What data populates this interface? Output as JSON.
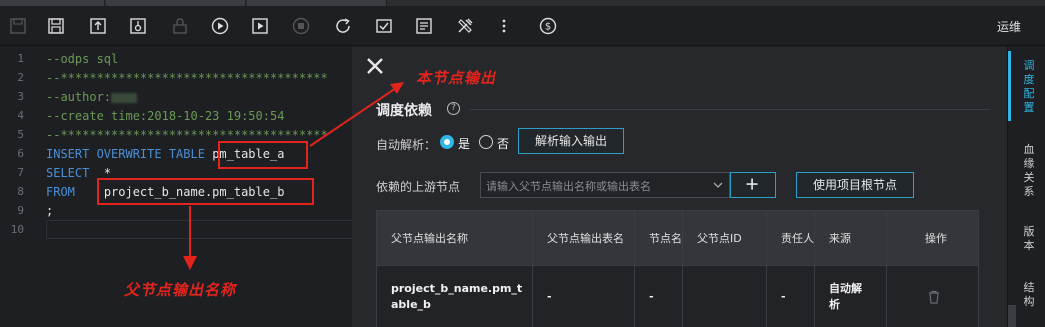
{
  "toolbar": {
    "buttons": [
      "save-icon",
      "submit-icon",
      "steal-lock-icon",
      "unlock-icon",
      "run-icon",
      "run-with-params-icon",
      "stop-icon",
      "reload-icon",
      "precompile-icon",
      "format-icon",
      "tools-icon",
      "more-icon",
      "cost-estimate-icon"
    ],
    "ops_label": "运维"
  },
  "editor": {
    "line_numbers": [
      "1",
      "2",
      "3",
      "4",
      "5",
      "6",
      "7",
      "8",
      "9",
      "10"
    ],
    "lines": {
      "l1": "--odps sql",
      "l2": "--*************************************",
      "l3": "--author:",
      "l4": "--create time:2018-10-23 19:50:54",
      "l5": "--*************************************",
      "l6_kw": "INSERT OVERWRITE TABLE",
      "l6_id": "pm_table_a",
      "l7_kw": "SELECT",
      "l7_id": "*",
      "l8_kw": "FROM",
      "l8_id": "project_b_name.pm_table_b",
      "l9": ";"
    }
  },
  "panel": {
    "section_title": "调度依赖",
    "help": "?",
    "auto_parse_label": "自动解析：",
    "auto_parse_yes": "是",
    "auto_parse_no": "否",
    "parse_io_button": "解析输入输出",
    "upstream_label": "依赖的上游节点",
    "upstream_placeholder": "请输入父节点输出名称或输出表名",
    "add_button": "+",
    "root_node_button": "使用项目根节点",
    "table": {
      "headers": [
        "父节点输出名称",
        "父节点输出表名",
        "节点名",
        "父节点ID",
        "责任人",
        "来源",
        "操作"
      ],
      "rows": [
        {
          "output_name": "project_b_name.pm_table_b",
          "output_table": "-",
          "node_name": "-",
          "node_id": "",
          "owner": "-",
          "source": "自动解析",
          "action": "trash-icon"
        }
      ]
    }
  },
  "right_bar": {
    "tabs": [
      "调度配置",
      "血缘关系",
      "版本",
      "结构"
    ],
    "active": "调度配置"
  },
  "annotations": {
    "this_node_output": "本节点输出",
    "parent_node_output_name": "父节点输出名称"
  },
  "colors": {
    "accent": "#2fb6e6",
    "annotation_red": "#e2241c",
    "comment_green": "#6a9955",
    "keyword_blue": "#4a8fd6"
  }
}
